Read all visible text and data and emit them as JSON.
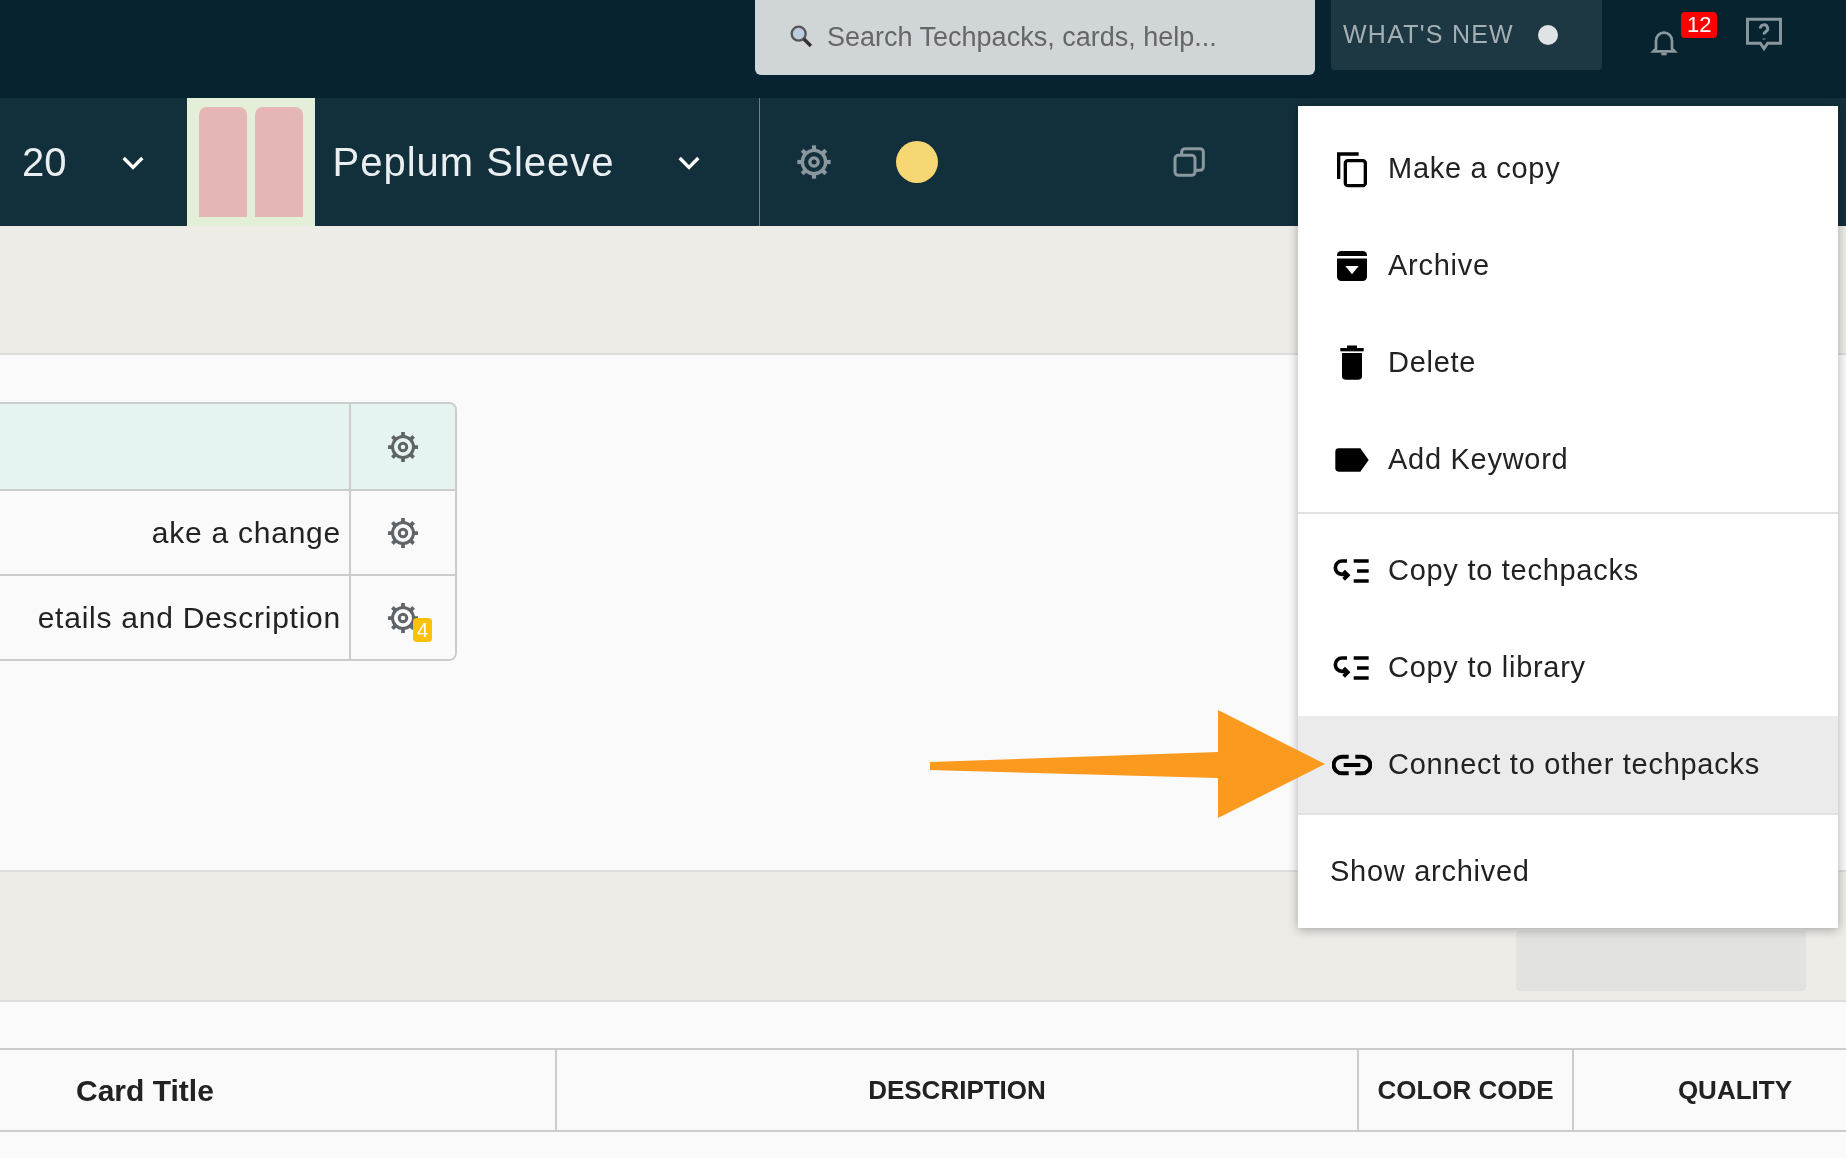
{
  "top_bar": {
    "search": {
      "placeholder": "Search Techpacks, cards, help..."
    },
    "whats_new": {
      "label": "WHAT'S NEW",
      "unread": true
    },
    "notifications": {
      "count": "12"
    }
  },
  "techpack_bar": {
    "prev_title": "20",
    "title": "Peplum Sleeve"
  },
  "cards_table": {
    "rows": [
      {
        "text": "",
        "selected": true
      },
      {
        "text": "ake a change",
        "selected": false
      },
      {
        "text": "etails and Description",
        "selected": false,
        "badge": "4"
      }
    ]
  },
  "materials_table": {
    "columns": [
      "Card Title",
      "DESCRIPTION",
      "COLOR CODE",
      "QUALITY"
    ]
  },
  "menu": {
    "sections": [
      [
        {
          "kind": "copy",
          "label": "Make a copy",
          "selected": false
        },
        {
          "kind": "archive",
          "label": "Archive",
          "selected": false
        },
        {
          "kind": "delete",
          "label": "Delete",
          "selected": false
        },
        {
          "kind": "tag",
          "label": "Add Keyword",
          "selected": false
        }
      ],
      [
        {
          "kind": "transfer",
          "label": "Copy to techpacks",
          "selected": false
        },
        {
          "kind": "transfer",
          "label": "Copy to library",
          "selected": false
        },
        {
          "kind": "link",
          "label": "Connect to other techpacks",
          "selected": true
        }
      ],
      [
        {
          "kind": "text",
          "label": "Show archived",
          "selected": false
        }
      ]
    ]
  }
}
